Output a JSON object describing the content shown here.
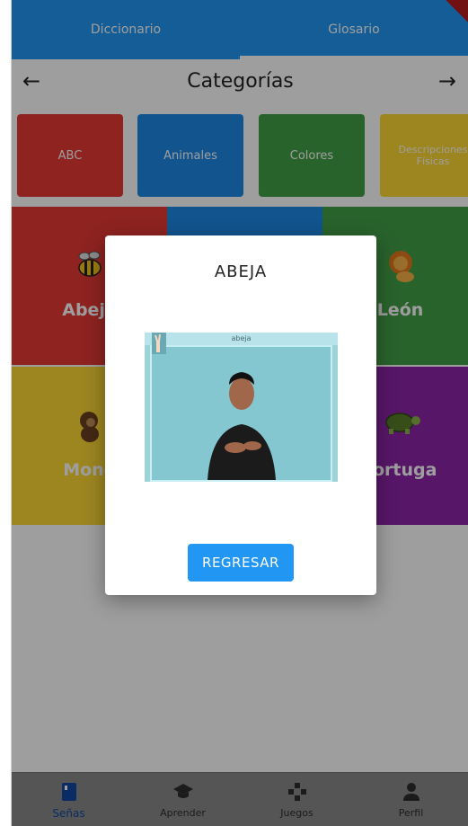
{
  "tabs": [
    {
      "label": "Diccionario"
    },
    {
      "label": "Glosario"
    }
  ],
  "category_bar": {
    "title": "Categorías",
    "left_arrow": "←",
    "right_arrow": "→"
  },
  "categories": [
    {
      "label": "ABC",
      "color": "#e53935"
    },
    {
      "label": "Animales",
      "color": "#1e88e5"
    },
    {
      "label": "Colores",
      "color": "#43a047"
    },
    {
      "label": "Descripciones Físicas",
      "color": "#fdd835"
    }
  ],
  "tiles": [
    {
      "label": "Abeja",
      "color": "#e53935"
    },
    {
      "label": "",
      "color": "#1e88e5"
    },
    {
      "label": "León",
      "color": "#43a047"
    },
    {
      "label": "Mono",
      "color": "#fdd835"
    },
    {
      "label": "",
      "color": "#ffffff"
    },
    {
      "label": "Tortuga",
      "color": "#8e24aa"
    }
  ],
  "dialog": {
    "title": "ABEJA",
    "video_caption": "abeja",
    "button_label": "REGRESAR"
  },
  "bottom_nav": [
    {
      "label": "Señas",
      "icon": "book-icon",
      "active": true
    },
    {
      "label": "Aprender",
      "icon": "graduation-cap-icon",
      "active": false
    },
    {
      "label": "Juegos",
      "icon": "gamepad-icon",
      "active": false
    },
    {
      "label": "Perfil",
      "icon": "person-icon",
      "active": false
    }
  ],
  "colors": {
    "primary": "#2196f3",
    "nav_active": "#0d47a1"
  }
}
